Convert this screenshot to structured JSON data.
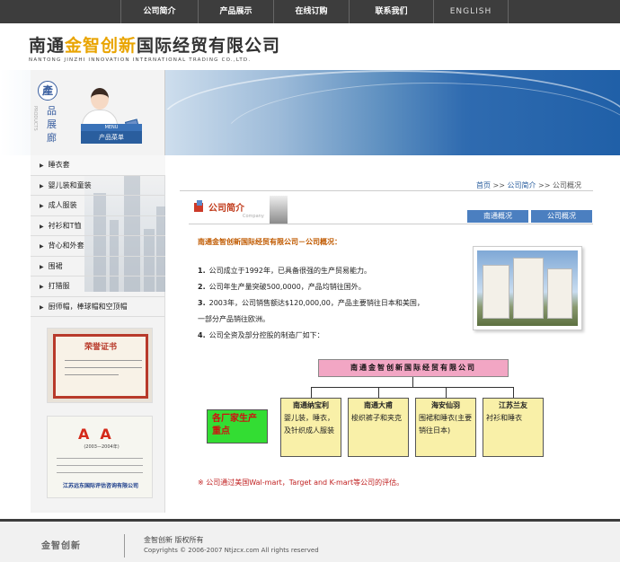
{
  "nav": {
    "items": [
      "公司简介",
      "产品展示",
      "在线订购",
      "联系我们",
      "ENGLISH"
    ]
  },
  "logo": {
    "cn_pre": "南通",
    "cn_gold": "金智创新",
    "cn_post": "国际经贸有限公司",
    "en": "NANTONG JINZHI INNOVATION INTERNATIONAL TRADING CO.,LTD."
  },
  "sidebar": {
    "seal_char": "產",
    "vertical_chars": [
      "品",
      "展",
      "廊"
    ],
    "vertical_en": "PRODUCTS",
    "menu_tag": "产品菜单",
    "menu_tag_en": "MENU",
    "items": [
      "睡衣套",
      "婴儿装和童装",
      "成人服装",
      "衬衫和T恤",
      "背心和外套",
      "围裙",
      "打猎服",
      "厨师帽，棒球帽和空顶帽"
    ],
    "certificate": {
      "title": "荣誉证书"
    },
    "credit": {
      "grade": "AA",
      "period": "(2003—2004年)",
      "agency": "江苏远东国际评估咨询有限公司"
    }
  },
  "breadcrumb": {
    "home": "首页",
    "sep": ">>",
    "level1": "公司简介",
    "current": "公司概况"
  },
  "section": {
    "title": "公司简介",
    "subtitle": "Company",
    "tabs": [
      "南通概况",
      "公司概况"
    ]
  },
  "content": {
    "heading": "南通金智创新国际经贸有限公司－公司概况：",
    "paragraphs": [
      {
        "num": "1.",
        "text": "公司成立于1992年，已具备很强的生产贸易能力。"
      },
      {
        "num": "2.",
        "text": "公司年生产量突破500,0000，产品均销往国外。"
      },
      {
        "num": "3.",
        "text": "2003年，公司销售额达$120,000,00，产品主要销往日本和美国，"
      },
      {
        "num": "",
        "text": "一部分产品销往欧洲。"
      },
      {
        "num": "4.",
        "text": "公司全资及部分控股的制造厂如下："
      }
    ]
  },
  "org_chart": {
    "top": "南通金智创新国际经贸有限公司",
    "side": "各厂家生产重点",
    "factories": [
      {
        "name": "南通纳宝利",
        "desc": "婴儿装，睡衣，及针织成人服装"
      },
      {
        "name": "南通大甫",
        "desc": "梭织裤子和夹克"
      },
      {
        "name": "海安仙羽",
        "desc": "围裙和睡衣(主要销往日本)"
      },
      {
        "name": "江苏兰友",
        "desc": "衬衫和睡衣"
      }
    ]
  },
  "note": "※ 公司通过美国Wal-mart，Target and K-mart等公司的评估。",
  "footer": {
    "logo": "金智创新",
    "line1": "金智创新  版权所有",
    "line2": "Copyrights © 2006-2007 Ntjzcx.com All rights reserved"
  }
}
